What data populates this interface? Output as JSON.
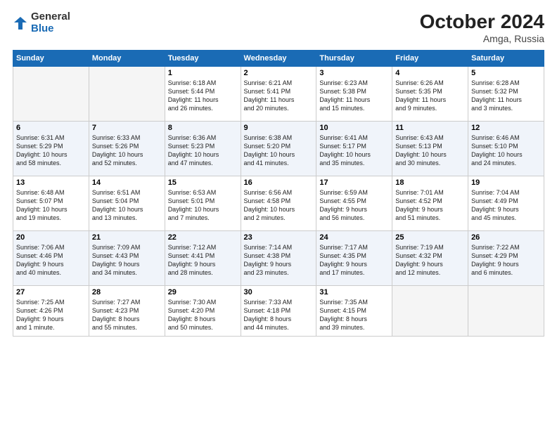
{
  "logo": {
    "general": "General",
    "blue": "Blue"
  },
  "title": "October 2024",
  "location": "Amga, Russia",
  "headers": [
    "Sunday",
    "Monday",
    "Tuesday",
    "Wednesday",
    "Thursday",
    "Friday",
    "Saturday"
  ],
  "weeks": [
    [
      {
        "day": "",
        "info": ""
      },
      {
        "day": "",
        "info": ""
      },
      {
        "day": "1",
        "info": "Sunrise: 6:18 AM\nSunset: 5:44 PM\nDaylight: 11 hours\nand 26 minutes."
      },
      {
        "day": "2",
        "info": "Sunrise: 6:21 AM\nSunset: 5:41 PM\nDaylight: 11 hours\nand 20 minutes."
      },
      {
        "day": "3",
        "info": "Sunrise: 6:23 AM\nSunset: 5:38 PM\nDaylight: 11 hours\nand 15 minutes."
      },
      {
        "day": "4",
        "info": "Sunrise: 6:26 AM\nSunset: 5:35 PM\nDaylight: 11 hours\nand 9 minutes."
      },
      {
        "day": "5",
        "info": "Sunrise: 6:28 AM\nSunset: 5:32 PM\nDaylight: 11 hours\nand 3 minutes."
      }
    ],
    [
      {
        "day": "6",
        "info": "Sunrise: 6:31 AM\nSunset: 5:29 PM\nDaylight: 10 hours\nand 58 minutes."
      },
      {
        "day": "7",
        "info": "Sunrise: 6:33 AM\nSunset: 5:26 PM\nDaylight: 10 hours\nand 52 minutes."
      },
      {
        "day": "8",
        "info": "Sunrise: 6:36 AM\nSunset: 5:23 PM\nDaylight: 10 hours\nand 47 minutes."
      },
      {
        "day": "9",
        "info": "Sunrise: 6:38 AM\nSunset: 5:20 PM\nDaylight: 10 hours\nand 41 minutes."
      },
      {
        "day": "10",
        "info": "Sunrise: 6:41 AM\nSunset: 5:17 PM\nDaylight: 10 hours\nand 35 minutes."
      },
      {
        "day": "11",
        "info": "Sunrise: 6:43 AM\nSunset: 5:13 PM\nDaylight: 10 hours\nand 30 minutes."
      },
      {
        "day": "12",
        "info": "Sunrise: 6:46 AM\nSunset: 5:10 PM\nDaylight: 10 hours\nand 24 minutes."
      }
    ],
    [
      {
        "day": "13",
        "info": "Sunrise: 6:48 AM\nSunset: 5:07 PM\nDaylight: 10 hours\nand 19 minutes."
      },
      {
        "day": "14",
        "info": "Sunrise: 6:51 AM\nSunset: 5:04 PM\nDaylight: 10 hours\nand 13 minutes."
      },
      {
        "day": "15",
        "info": "Sunrise: 6:53 AM\nSunset: 5:01 PM\nDaylight: 10 hours\nand 7 minutes."
      },
      {
        "day": "16",
        "info": "Sunrise: 6:56 AM\nSunset: 4:58 PM\nDaylight: 10 hours\nand 2 minutes."
      },
      {
        "day": "17",
        "info": "Sunrise: 6:59 AM\nSunset: 4:55 PM\nDaylight: 9 hours\nand 56 minutes."
      },
      {
        "day": "18",
        "info": "Sunrise: 7:01 AM\nSunset: 4:52 PM\nDaylight: 9 hours\nand 51 minutes."
      },
      {
        "day": "19",
        "info": "Sunrise: 7:04 AM\nSunset: 4:49 PM\nDaylight: 9 hours\nand 45 minutes."
      }
    ],
    [
      {
        "day": "20",
        "info": "Sunrise: 7:06 AM\nSunset: 4:46 PM\nDaylight: 9 hours\nand 40 minutes."
      },
      {
        "day": "21",
        "info": "Sunrise: 7:09 AM\nSunset: 4:43 PM\nDaylight: 9 hours\nand 34 minutes."
      },
      {
        "day": "22",
        "info": "Sunrise: 7:12 AM\nSunset: 4:41 PM\nDaylight: 9 hours\nand 28 minutes."
      },
      {
        "day": "23",
        "info": "Sunrise: 7:14 AM\nSunset: 4:38 PM\nDaylight: 9 hours\nand 23 minutes."
      },
      {
        "day": "24",
        "info": "Sunrise: 7:17 AM\nSunset: 4:35 PM\nDaylight: 9 hours\nand 17 minutes."
      },
      {
        "day": "25",
        "info": "Sunrise: 7:19 AM\nSunset: 4:32 PM\nDaylight: 9 hours\nand 12 minutes."
      },
      {
        "day": "26",
        "info": "Sunrise: 7:22 AM\nSunset: 4:29 PM\nDaylight: 9 hours\nand 6 minutes."
      }
    ],
    [
      {
        "day": "27",
        "info": "Sunrise: 7:25 AM\nSunset: 4:26 PM\nDaylight: 9 hours\nand 1 minute."
      },
      {
        "day": "28",
        "info": "Sunrise: 7:27 AM\nSunset: 4:23 PM\nDaylight: 8 hours\nand 55 minutes."
      },
      {
        "day": "29",
        "info": "Sunrise: 7:30 AM\nSunset: 4:20 PM\nDaylight: 8 hours\nand 50 minutes."
      },
      {
        "day": "30",
        "info": "Sunrise: 7:33 AM\nSunset: 4:18 PM\nDaylight: 8 hours\nand 44 minutes."
      },
      {
        "day": "31",
        "info": "Sunrise: 7:35 AM\nSunset: 4:15 PM\nDaylight: 8 hours\nand 39 minutes."
      },
      {
        "day": "",
        "info": ""
      },
      {
        "day": "",
        "info": ""
      }
    ]
  ]
}
